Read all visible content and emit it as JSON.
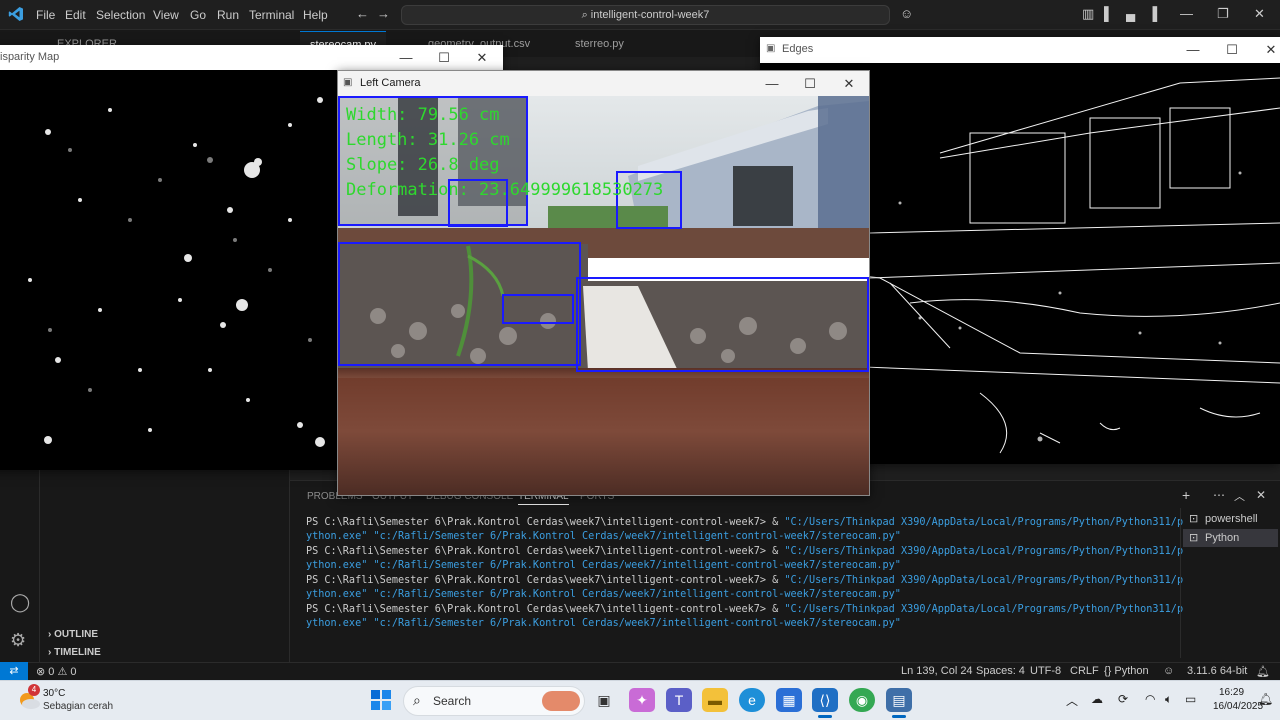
{
  "vscode": {
    "menu": [
      "File",
      "Edit",
      "Selection",
      "View",
      "Go",
      "Run",
      "Terminal",
      "Help"
    ],
    "command_center": "intelligent-control-week7",
    "tabs": [
      "EXPLORER",
      "stereocam.py",
      "geometry_output.csv",
      "sterreo.py"
    ],
    "sidebar": {
      "outline": "OUTLINE",
      "timeline": "TIMELINE"
    },
    "panel_tabs": [
      "PROBLEMS",
      "OUTPUT",
      "DEBUG CONSOLE",
      "TERMINAL",
      "PORTS"
    ],
    "terminal": {
      "prompt": "PS C:\\Rafli\\Semester 6\\Prak.Kontrol Cerdas\\week7\\intelligent-control-week7> & ",
      "cmd1": "\"C:/Users/Thinkpad X390/AppData/Local/Programs/Python/Python311/p",
      "cmd2": "ython.exe\" \"c:/Rafli/Semester 6/Prak.Kontrol Cerdas/week7/intelligent-control-week7/stereocam.py\""
    },
    "terminal_list": [
      "powershell",
      "Python"
    ],
    "status": {
      "errors": "0",
      "warnings": "0",
      "position": "Ln 139, Col 24",
      "spaces": "Spaces: 4",
      "encoding": "UTF-8",
      "eol": "CRLF",
      "language": "Python",
      "interpreter": "3.11.6 64-bit"
    }
  },
  "windows": {
    "disparity_title": "isparity Map",
    "left_camera_title": "Left Camera",
    "edges_title": "Edges"
  },
  "overlay": {
    "width": "Width: 79.56 cm",
    "length": "Length: 31.26 cm",
    "slope": "Slope: 26.8 deg",
    "deformation": "Deformation: 23.649999618530273"
  },
  "taskbar": {
    "temp": "30°C",
    "weather": "Sebagian cerah",
    "weather_badge": "4",
    "search": "Search",
    "time": "16:29",
    "date": "16/04/2025"
  },
  "colors": {
    "accent": "#0078d4",
    "overlay_green": "#2ed82e",
    "bbox_blue": "#1a1aff"
  }
}
